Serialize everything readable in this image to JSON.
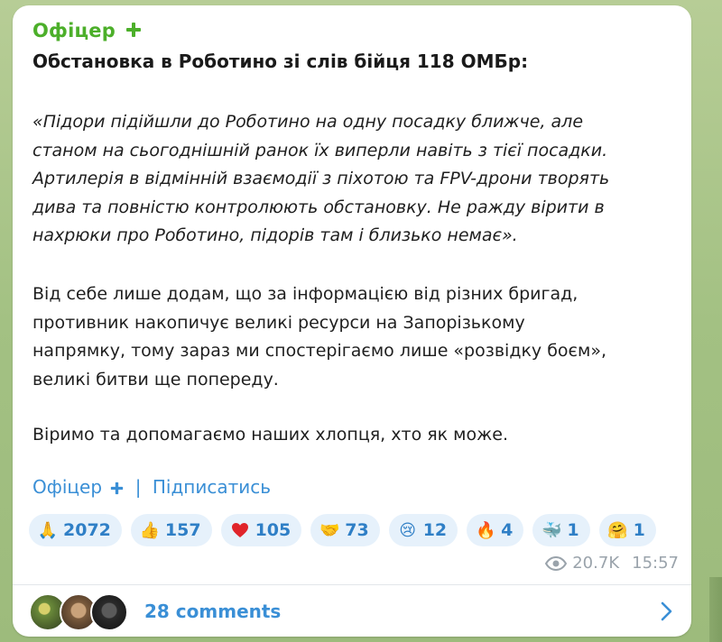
{
  "post": {
    "channel_name": "Офіцер",
    "channel_icon": "plus-icon",
    "headline": "Обстановка в Роботино зі слів бійця 118 ОМБр:",
    "quote_lines": [
      "«Підори підійшли до Роботино на одну посадку ближче, але",
      "станом на сьогоднішній ранок їх виперли навіть з тієї посадки.",
      "Артилерія в відмінній взаємодії з піхотою та FPV-дрони творять",
      "дива та повністю контролюють обстановку. Не ражду вірити в",
      "нахрюки про Роботино, підорів там і близько немає»."
    ],
    "paragraph_lines": [
      "Від себе лише додам, що за інформацією від різних бригад,",
      "противник накопичує великі ресурси на Запорізькому",
      "напрямку, тому зараз ми спостерігаємо лише «розвідку боєм»,",
      "великі битви ще попереду."
    ],
    "closing_line": "Віримо та допомагаємо наших хлопця, хто як може.",
    "signature": {
      "channel_link": "Офіцер",
      "separator": "|",
      "subscribe_link": "Підписатись"
    }
  },
  "reactions": [
    {
      "emoji": "🙏",
      "icon": "pray-icon",
      "count": "2072"
    },
    {
      "emoji": "👍",
      "icon": "thumbs-up-icon",
      "count": "157"
    },
    {
      "emoji": "❤",
      "icon": "heart-icon",
      "count": "105"
    },
    {
      "emoji": "🤝",
      "icon": "hand-icon",
      "count": "73"
    },
    {
      "emoji": "😢",
      "icon": "crying-face-icon",
      "count": "12"
    },
    {
      "emoji": "🔥",
      "icon": "fire-icon",
      "count": "4"
    },
    {
      "emoji": "🐳",
      "icon": "whale-icon",
      "count": "1"
    },
    {
      "emoji": "🤗",
      "icon": "hugging-face-icon",
      "count": "1"
    }
  ],
  "meta": {
    "views": "20.7K",
    "time": "15:57"
  },
  "comments": {
    "label": "28 comments"
  },
  "colors": {
    "accent_green": "#4caf2a",
    "link_blue": "#3a8fd6",
    "reaction_bg": "#e6f1fb",
    "meta_gray": "#9aa3ab"
  }
}
